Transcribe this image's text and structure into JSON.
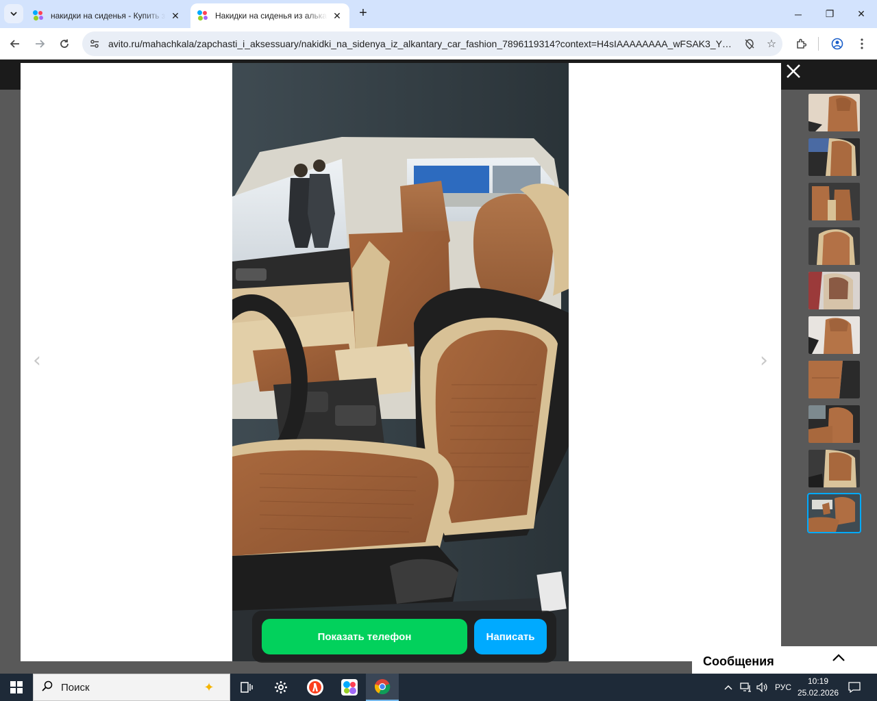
{
  "browser": {
    "tabs": [
      {
        "title": "накидки на сиденья - Купить з",
        "active": false
      },
      {
        "title": "Накидки на сиденья из алькан",
        "active": true
      }
    ],
    "new_tab": "+",
    "url": "avito.ru/mahachkala/zapchasti_i_aksessuary/nakidki_na_sidenya_iz_alkantary_car_fashion_7896119314?context=H4sIAAAAAAAA_wFSAK3_YTozOn...",
    "window_controls": {
      "minimize": "─",
      "maximize": "❐",
      "close": "✕"
    }
  },
  "gallery": {
    "prev_arrow": "‹",
    "next_arrow": "›",
    "thumbnail_count": 10,
    "selected_thumbnail": 10
  },
  "actions": {
    "show_phone": "Показать телефон",
    "write": "Написать"
  },
  "messages": {
    "label": "Сообщения"
  },
  "taskbar": {
    "search_placeholder": "Поиск",
    "language": "РУС",
    "time": "10:19",
    "date": "25.02.2026"
  },
  "colors": {
    "show_phone_button": "#02d15c",
    "write_button": "#00aaff",
    "selected_thumbnail_border": "#00aaff"
  }
}
